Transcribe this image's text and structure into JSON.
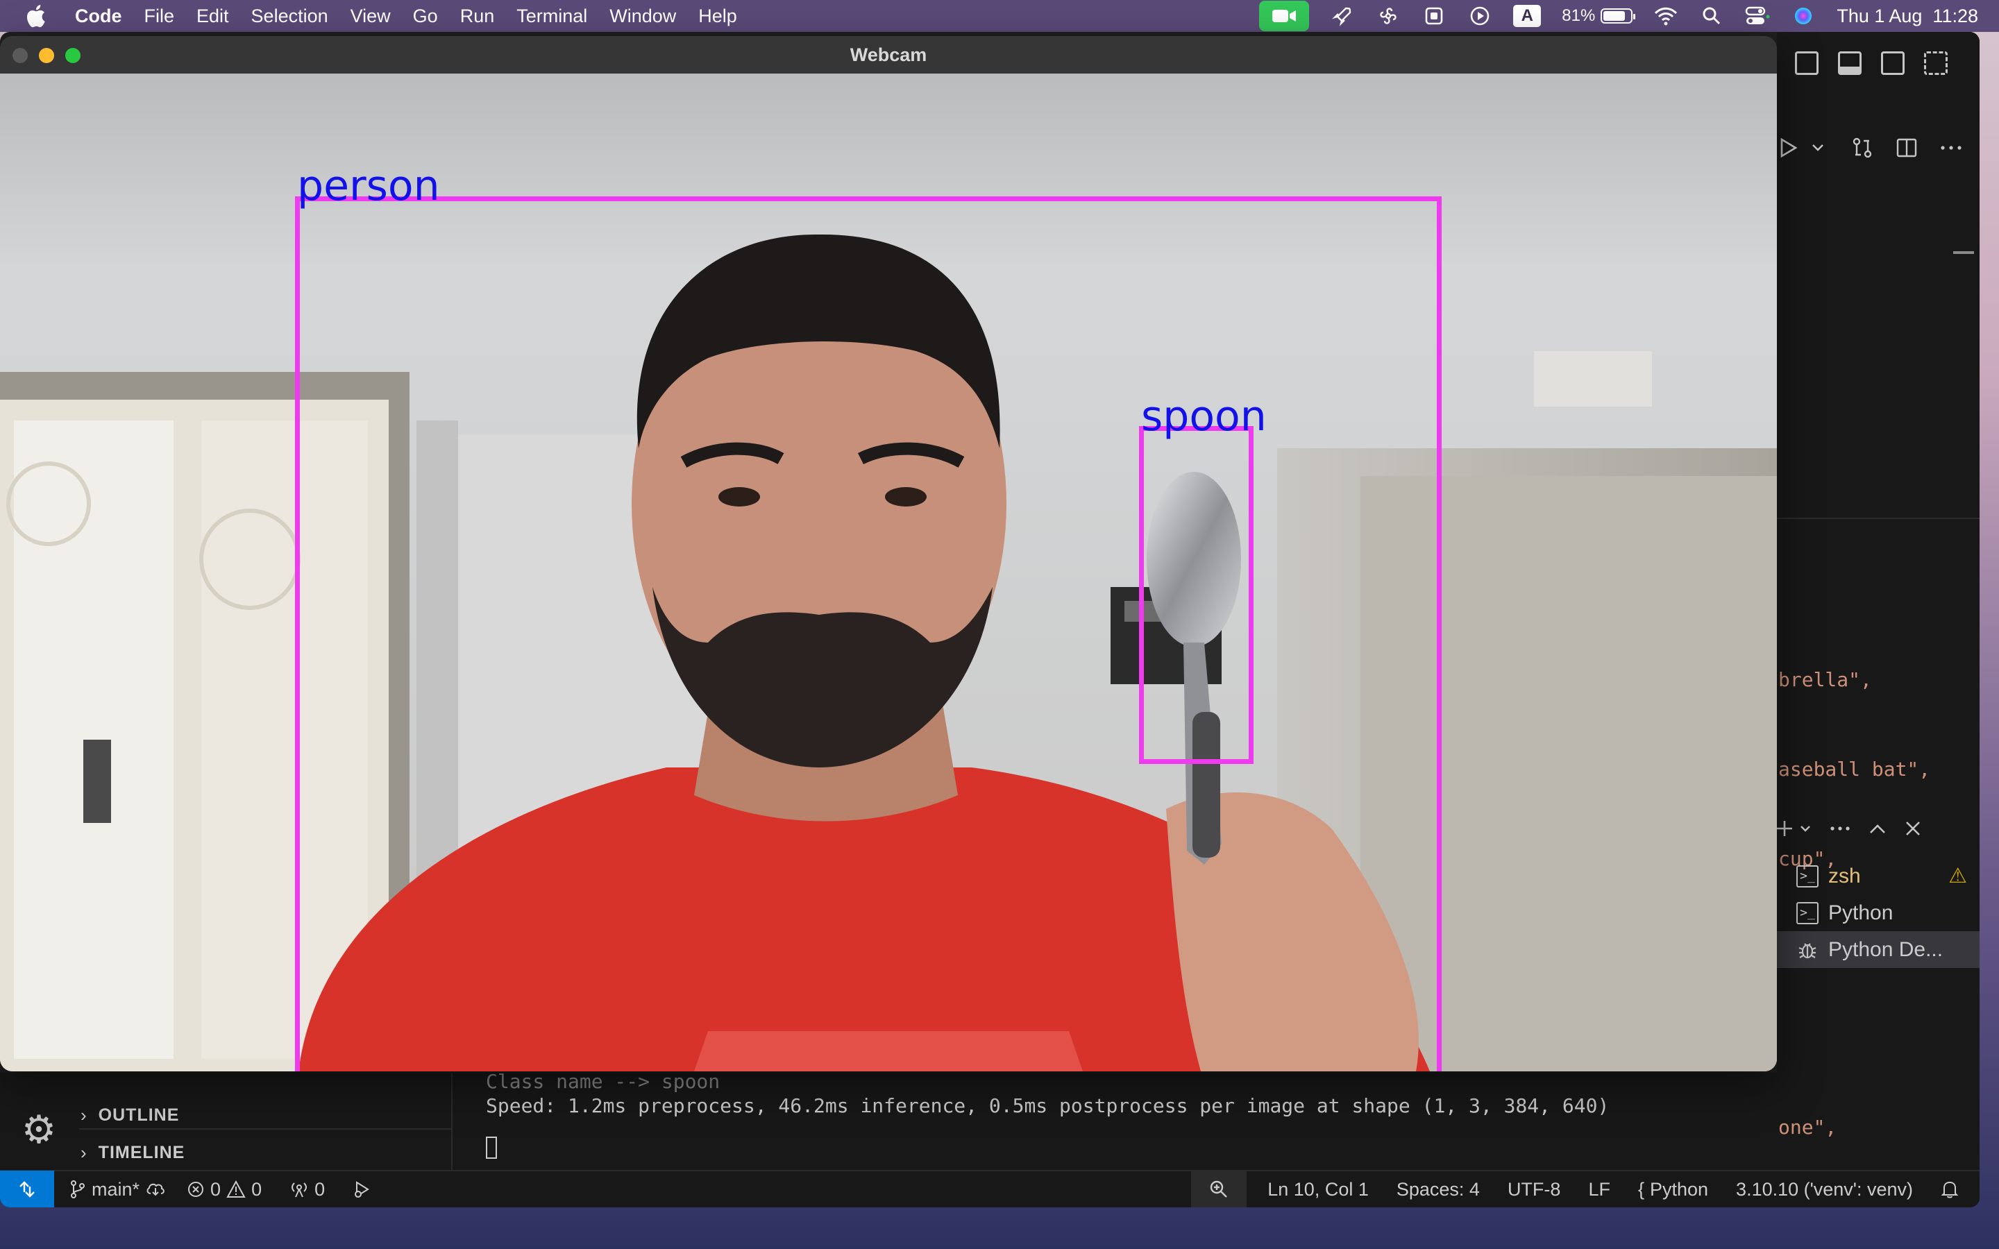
{
  "menubar": {
    "app_name": "Code",
    "items": [
      "File",
      "Edit",
      "Selection",
      "View",
      "Go",
      "Run",
      "Terminal",
      "Window",
      "Help"
    ],
    "battery_percent": "81%",
    "battery_level": 0.81,
    "input_source": "A",
    "datetime": "Thu 1 Aug  11:28",
    "icons": [
      "apple-icon",
      "camera-in-use-icon",
      "rocket-icon",
      "pinwheel-icon",
      "clipboard-icon",
      "play-circle-icon",
      "input-source-icon",
      "battery-icon",
      "wifi-icon",
      "search-icon",
      "control-center-icon",
      "siri-icon"
    ]
  },
  "webcam": {
    "title": "Webcam",
    "detections": [
      {
        "label": "person"
      },
      {
        "label": "spoon"
      }
    ]
  },
  "vscode": {
    "code_peek": [
      "brella\",",
      "aseball bat\",",
      "cup\",",
      "",
      "",
      "one\",",
      "  \""
    ],
    "terminal_tabs": [
      {
        "name": "zsh",
        "icon": "terminal-icon",
        "warning": true
      },
      {
        "name": "Python",
        "icon": "terminal-icon",
        "warning": false
      },
      {
        "name": "Python De...",
        "icon": "debug-icon",
        "warning": false
      }
    ],
    "sidebar_sections": [
      "OUTLINE",
      "TIMELINE"
    ],
    "terminal_output": {
      "line1": "Class name --> spoon",
      "line2": "Speed: 1.2ms preprocess, 46.2ms inference, 0.5ms postprocess per image at shape (1, 3, 384, 640)"
    },
    "statusbar": {
      "branch": "main*",
      "errors": "0",
      "warnings": "0",
      "ports": "0",
      "position": "Ln 10, Col 1",
      "spaces": "Spaces: 4",
      "encoding": "UTF-8",
      "eol": "LF",
      "language": "Python",
      "interpreter": "3.10.10 ('venv': venv)"
    }
  }
}
